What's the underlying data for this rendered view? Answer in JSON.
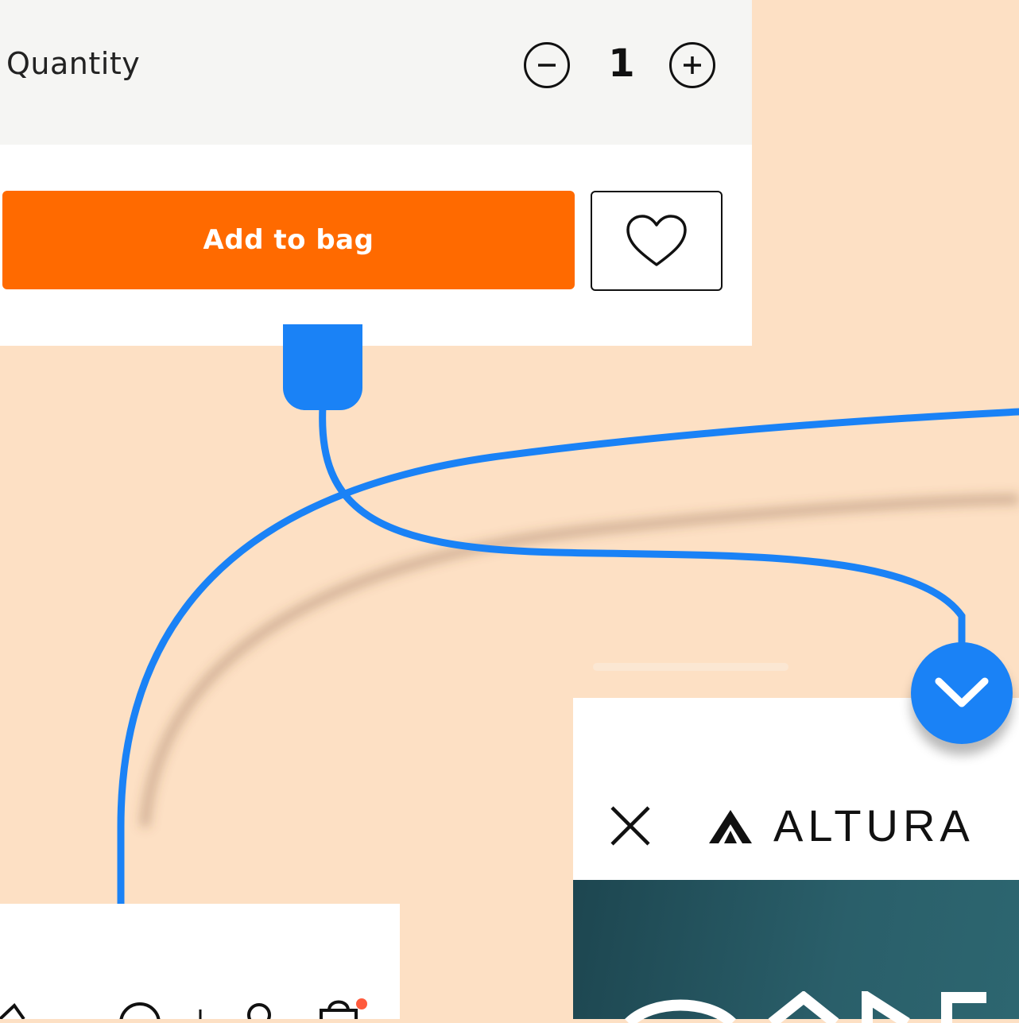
{
  "product": {
    "quantity_label": "Quantity",
    "quantity_value": "1",
    "add_to_bag_label": "Add to bag"
  },
  "site_header": {
    "brand_name": "ALTURA"
  },
  "colors": {
    "background": "#fde0c4",
    "accent_orange": "#ff6a00",
    "connector_blue": "#1a82f6"
  },
  "icons": {
    "minus": "minus-circle-icon",
    "plus": "plus-circle-icon",
    "wishlist": "heart-icon",
    "close": "close-icon",
    "logo": "altura-logo-icon",
    "collapse": "chevron-down-icon"
  }
}
